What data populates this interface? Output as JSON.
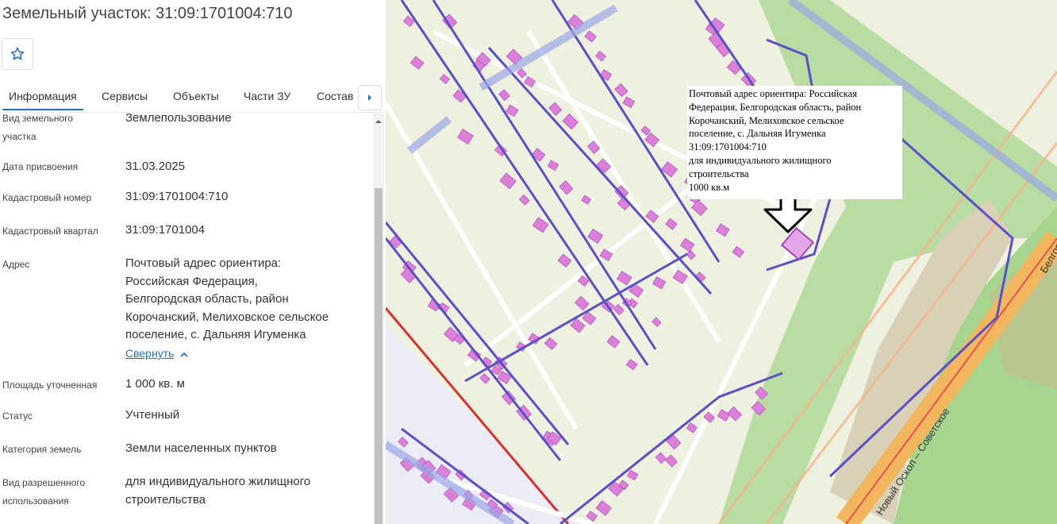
{
  "header": {
    "title": "Земельный участок: 31:09:1701004:710"
  },
  "tabs": [
    {
      "label": "Информация",
      "active": true
    },
    {
      "label": "Сервисы"
    },
    {
      "label": "Объекты"
    },
    {
      "label": "Части ЗУ"
    },
    {
      "label": "Состав"
    }
  ],
  "fields": {
    "land_use_type": {
      "label_1": "Вид земельного",
      "label_2": "участка",
      "value": "Землепользование"
    },
    "assign_date": {
      "label": "Дата присвоения",
      "value": "31.03.2025"
    },
    "cadastral_number": {
      "label": "Кадастровый номер",
      "value": "31:09:1701004:710"
    },
    "cadastral_block": {
      "label": "Кадастровый квартал",
      "value": "31:09:1701004"
    },
    "address": {
      "label": "Адрес",
      "lines": [
        "Почтовый адрес ориентира:",
        "Российская Федерация,",
        "Белгородская область, район",
        "Корочанский, Мелиховское сельское",
        "поселение, с. Дальняя Игуменка"
      ],
      "collapse_label": "Свернуть"
    },
    "area": {
      "label": "Площадь уточненная",
      "value": "1 000 кв. м"
    },
    "status": {
      "label": "Статус",
      "value": "Учтенный"
    },
    "land_category": {
      "label": "Категория земель",
      "value": "Земли населенных пунктов"
    },
    "permitted_use": {
      "label_1": "Вид разрешенного",
      "label_2": "использования",
      "value_1": "для индивидуального жилищного",
      "value_2": "строительства"
    }
  },
  "map": {
    "popup_lines": [
      "Почтовый адрес ориентира: Российская",
      "Федерация, Белгородская область, район",
      "Корочанский, Мелиховское сельское",
      "поселение, с. Дальняя Игуменка",
      "31:09:1701004:710",
      "для индивидуального жилищного",
      "строительства",
      "1000 кв.м"
    ],
    "road_label": "Новый Оскол – Советское",
    "road_label_2": "Белгород",
    "colors": {
      "background": "#eef0e0",
      "parcel": "#dc7fd8",
      "parcel_border": "#a244b8",
      "boundary": "#5b4fc7",
      "road": "#f2b75e",
      "green": "#9ecf8a",
      "accent": "#1e6fd9"
    },
    "icons": [
      "selected-parcel-arrow-icon"
    ]
  }
}
